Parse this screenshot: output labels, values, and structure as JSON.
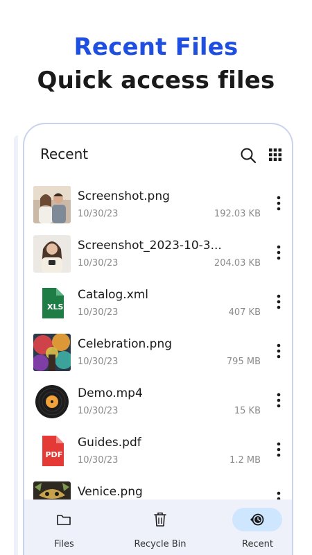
{
  "hero": {
    "title": "Recent Files",
    "subtitle": "Quick access files"
  },
  "header": {
    "title": "Recent",
    "search_icon": "search-icon",
    "grid_icon": "grid-view-icon"
  },
  "files": [
    {
      "name": "Screenshot.png",
      "date": "10/30/23",
      "size": "192.03 KB",
      "thumb": "photo-couple"
    },
    {
      "name": "Screenshot_2023-10-3...",
      "date": "10/30/23",
      "size": "204.03 KB",
      "thumb": "photo-woman"
    },
    {
      "name": "Catalog.xml",
      "date": "10/30/23",
      "size": "407 KB",
      "thumb": "xls-file-icon",
      "thumb_label": "XLS"
    },
    {
      "name": "Celebration.png",
      "date": "10/30/23",
      "size": "795 MB",
      "thumb": "photo-color-powder"
    },
    {
      "name": "Demo.mp4",
      "date": "10/30/23",
      "size": "15 KB",
      "thumb": "vinyl-video-icon"
    },
    {
      "name": "Guides.pdf",
      "date": "10/30/23",
      "size": "1.2 MB",
      "thumb": "pdf-file-icon",
      "thumb_label": "PDF"
    },
    {
      "name": "Venice.png",
      "date": "",
      "size": "",
      "thumb": "photo-venice-mask"
    }
  ],
  "nav": {
    "files": "Files",
    "recycle_bin": "Recycle Bin",
    "recent": "Recent",
    "active": "recent"
  },
  "colors": {
    "accent": "#1f4fe0",
    "nav_background": "#eef1f9",
    "nav_active_pill": "#cfe6ff",
    "xls_green": "#1e7d45",
    "pdf_red": "#e53935",
    "muted_text": "#8a8a8a"
  }
}
